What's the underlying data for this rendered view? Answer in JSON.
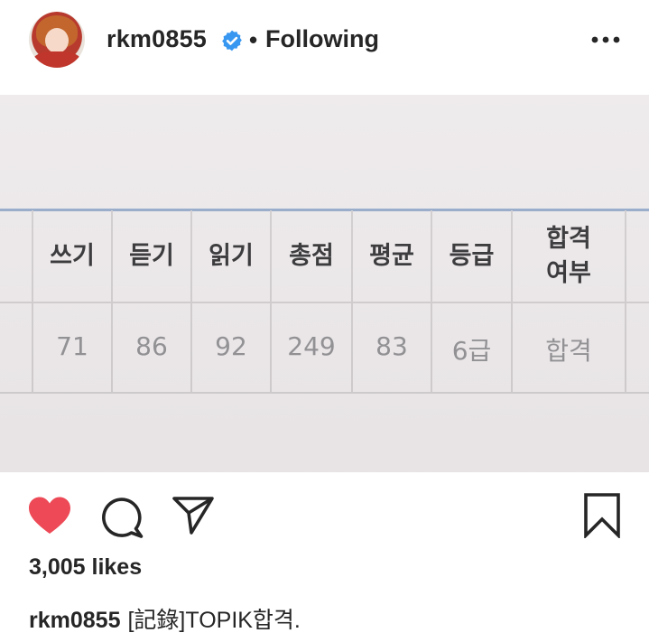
{
  "post": {
    "username": "rkm0855",
    "separator": "•",
    "follow_status": "Following",
    "verified": true,
    "likes": "3,005 likes",
    "caption": "[記錄]TOPIK합격."
  },
  "table": {
    "headers": [
      "쓰기",
      "듣기",
      "읽기",
      "총점",
      "평균",
      "등급"
    ],
    "last_header_line1": "합격",
    "last_header_line2": "여부",
    "values": [
      "71",
      "86",
      "92",
      "249",
      "83",
      "6급",
      "합격"
    ]
  },
  "icons": {
    "avatar": "profile-photo",
    "verified": "verified-badge-icon",
    "more": "more-options-icon",
    "like": "heart-icon",
    "comment": "comment-icon",
    "share": "share-icon",
    "save": "bookmark-icon"
  },
  "colors": {
    "heart": "#ed4956",
    "verified": "#3897f0",
    "text": "#262626",
    "table_rule": "#8fa6c6"
  }
}
